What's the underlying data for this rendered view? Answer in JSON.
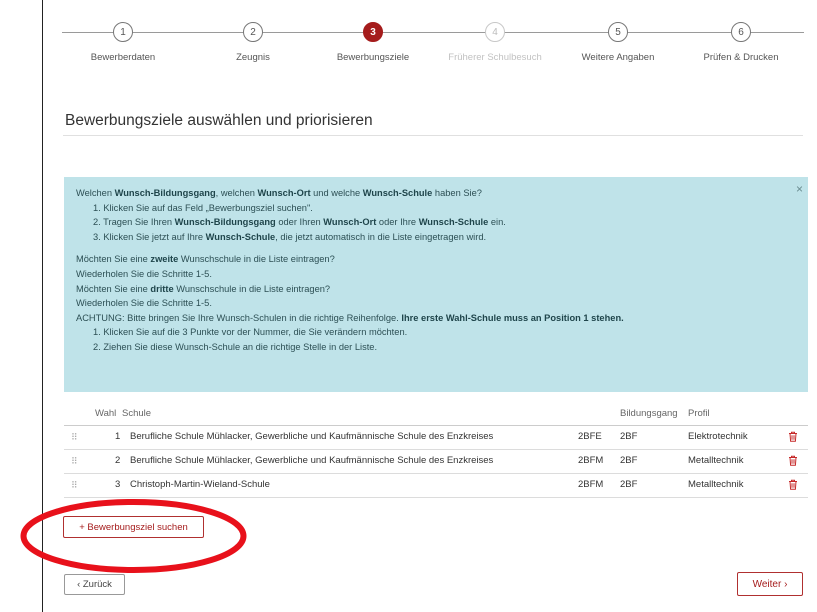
{
  "stepper": {
    "steps": [
      {
        "number": "1",
        "label": "Bewerberdaten"
      },
      {
        "number": "2",
        "label": "Zeugnis"
      },
      {
        "number": "3",
        "label": "Bewerbungsziele"
      },
      {
        "number": "4",
        "label": "Früherer Schulbesuch"
      },
      {
        "number": "5",
        "label": "Weitere Angaben"
      },
      {
        "number": "6",
        "label": "Prüfen & Drucken"
      }
    ],
    "active_step": "3"
  },
  "page_title": "Bewerbungsziele auswählen und priorisieren",
  "info": {
    "close": "×",
    "q1_a": "Welchen ",
    "q1_b": "Wunsch-Bildungsgang",
    "q1_c": ", welchen ",
    "q1_d": "Wunsch-Ort",
    "q1_e": " und welche ",
    "q1_f": "Wunsch-Schule",
    "q1_g": " haben Sie?",
    "s1": "1. Klicken Sie auf das Feld „Bewerbungsziel suchen\".",
    "s2_a": "2. Tragen Sie Ihren ",
    "s2_b": "Wunsch-Bildungsgang",
    "s2_c": " oder Ihren ",
    "s2_d": "Wunsch-Ort",
    "s2_e": " oder Ihre ",
    "s2_f": "Wunsch-Schule",
    "s2_g": " ein.",
    "s3_a": "3. Klicken Sie jetzt auf Ihre ",
    "s3_b": "Wunsch-Schule",
    "s3_c": ", die jetzt automatisch in die Liste eingetragen wird.",
    "q2_a": "Möchten Sie eine ",
    "q2_b": "zweite",
    "q2_c": " Wunschschule in die Liste eintragen?",
    "r1": "Wiederholen Sie die Schritte 1-5.",
    "q3_a": "Möchten Sie eine ",
    "q3_b": "dritte",
    "q3_c": " Wunschschule in die Liste eintragen?",
    "r2": "Wiederholen Sie die Schritte 1-5.",
    "warn_a": "ACHTUNG: Bitte bringen Sie Ihre Wunsch-Schulen in die richtige Reihenfolge. ",
    "warn_b": "Ihre erste Wahl-Schule muss an Position 1 stehen.",
    "o1": "1. Klicken Sie auf die 3 Punkte vor der Nummer, die Sie verändern möchten.",
    "o2": "2. Ziehen Sie diese Wunsch-Schule an die richtige Stelle in der Liste."
  },
  "table": {
    "headers": {
      "wahl": "Wahl",
      "schule": "Schule",
      "bildungsgang": "Bildungsgang",
      "profil": "Profil"
    },
    "rows": [
      {
        "handle": "⠿",
        "wahl": "1",
        "schule": "Berufliche Schule Mühlacker, Gewerbliche und Kaufmännische Schule des Enzkreises",
        "code": "2BFE",
        "bildungsgang": "2BF",
        "profil": "Elektrotechnik"
      },
      {
        "handle": "⠿",
        "wahl": "2",
        "schule": "Berufliche Schule Mühlacker, Gewerbliche und Kaufmännische Schule des Enzkreises",
        "code": "2BFM",
        "bildungsgang": "2BF",
        "profil": "Metalltechnik"
      },
      {
        "handle": "⠿",
        "wahl": "3",
        "schule": "Christoph-Martin-Wieland-Schule",
        "code": "2BFM",
        "bildungsgang": "2BF",
        "profil": "Metalltechnik"
      }
    ]
  },
  "buttons": {
    "add": "+ Bewerbungsziel suchen",
    "back": "‹ Zurück",
    "next": "Weiter ›"
  },
  "colors": {
    "accent": "#a51c1c",
    "info_bg": "#bfe3e9",
    "annotation": "#e8111b"
  }
}
